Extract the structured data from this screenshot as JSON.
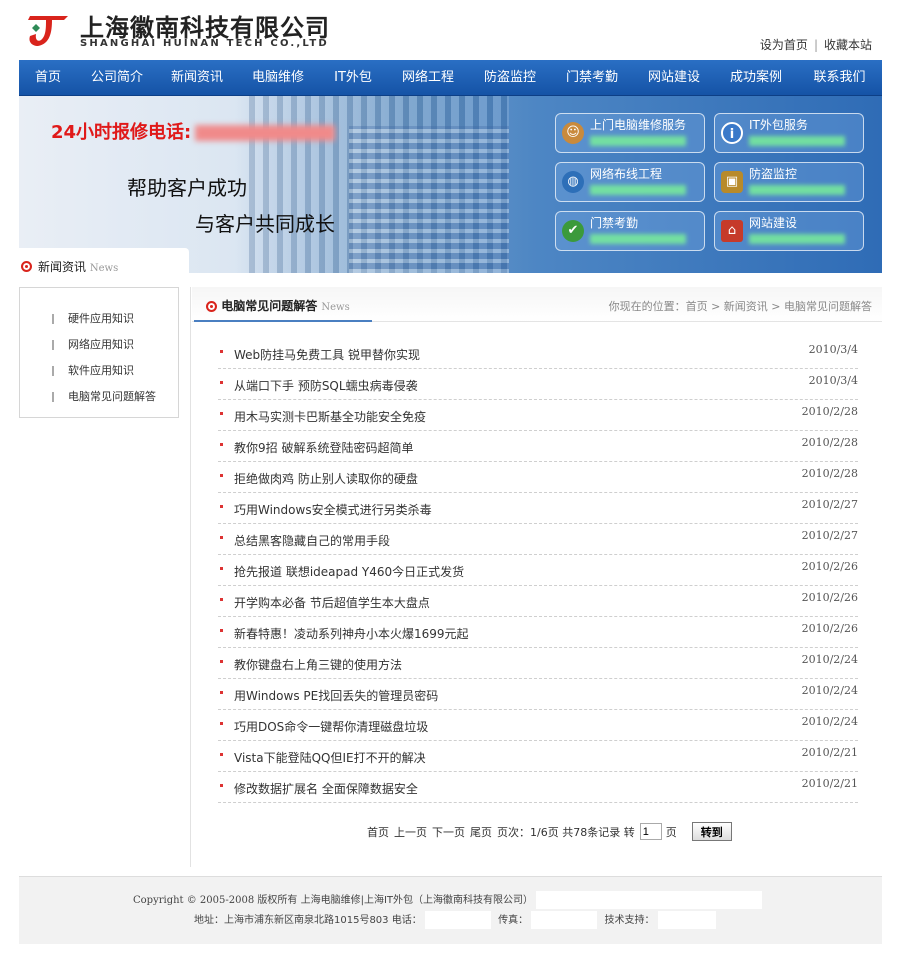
{
  "header": {
    "company_cn": "上海徽南科技有限公司",
    "company_en": "SHANGHAI HUINAN TECH CO.,LTD",
    "set_home": "设为首页",
    "bookmark": "收藏本站",
    "brand_color": "#d9241c"
  },
  "nav": {
    "items": [
      "首页",
      "公司简介",
      "新闻资讯",
      "电脑维修",
      "IT外包",
      "网络工程",
      "防盗监控",
      "门禁考勤",
      "网站建设",
      "成功案例",
      "联系我们"
    ]
  },
  "banner": {
    "hotline_label": "24小时报修电话:",
    "slogan1": "帮助客户成功",
    "slogan2": "与客户共同成长",
    "services": [
      {
        "title": "上门电脑维修服务",
        "icon": "technician-icon"
      },
      {
        "title": "IT外包服务",
        "icon": "info-icon"
      },
      {
        "title": "网络布线工程",
        "icon": "globe-icon"
      },
      {
        "title": "防盗监控",
        "icon": "lock-icon"
      },
      {
        "title": "门禁考勤",
        "icon": "shield-icon"
      },
      {
        "title": "网站建设",
        "icon": "home-icon"
      }
    ]
  },
  "sidebar": {
    "tab_label": "新闻资讯",
    "tab_en": "News",
    "items": [
      "硬件应用知识",
      "网络应用知识",
      "软件应用知识",
      "电脑常见问题解答"
    ]
  },
  "main": {
    "section_title": "电脑常见问题解答",
    "section_en": "News",
    "breadcrumb": "你现在的位置：首页 > 新闻资讯 > 电脑常见问题解答",
    "articles": [
      {
        "title": "Web防挂马免费工具 锐甲替你实现",
        "date": "2010/3/4"
      },
      {
        "title": "从端口下手 预防SQL蠕虫病毒侵袭",
        "date": "2010/3/4"
      },
      {
        "title": "用木马实测卡巴斯基全功能安全免疫",
        "date": "2010/2/28"
      },
      {
        "title": "教你9招 破解系统登陆密码超简单",
        "date": "2010/2/28"
      },
      {
        "title": "拒绝做肉鸡 防止别人读取你的硬盘",
        "date": "2010/2/28"
      },
      {
        "title": "巧用Windows安全模式进行另类杀毒",
        "date": "2010/2/27"
      },
      {
        "title": "总结黑客隐藏自己的常用手段",
        "date": "2010/2/27"
      },
      {
        "title": "抢先报道 联想ideapad Y460今日正式发货",
        "date": "2010/2/26"
      },
      {
        "title": "开学购本必备 节后超值学生本大盘点",
        "date": "2010/2/26"
      },
      {
        "title": "新春特惠！凌动系列神舟小本火爆1699元起",
        "date": "2010/2/26"
      },
      {
        "title": "教你键盘右上角三键的使用方法",
        "date": "2010/2/24"
      },
      {
        "title": "用Windows PE找回丢失的管理员密码",
        "date": "2010/2/24"
      },
      {
        "title": "巧用DOS命令一键帮你清理磁盘垃圾",
        "date": "2010/2/24"
      },
      {
        "title": "Vista下能登陆QQ但IE打不开的解决",
        "date": "2010/2/21"
      },
      {
        "title": "修改数据扩展名 全面保障数据安全",
        "date": "2010/2/21"
      }
    ]
  },
  "pager": {
    "first": "首页",
    "prev": "上一页",
    "next": "下一页",
    "last": "尾页",
    "page_info": "页次：1/6页 共78条记录 转",
    "page_value": "1",
    "page_unit": "页",
    "go": "转到"
  },
  "footer": {
    "copyright_en": "Copyright © 2005-2008",
    "copyright_cn": "版权所有 上海电脑维修|上海IT外包（上海徽南科技有限公司）",
    "address": "地址：上海市浦东新区南泉北路1015号803 电话：",
    "fax": "传真：",
    "support": "技术支持："
  }
}
